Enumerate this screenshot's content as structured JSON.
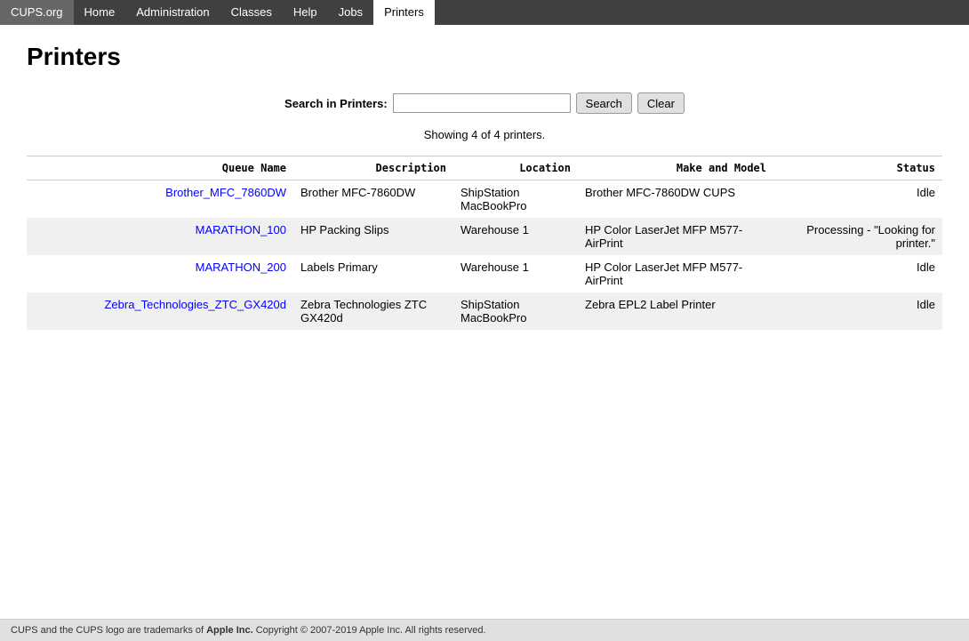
{
  "nav": {
    "brand": "CUPS.org",
    "items": [
      {
        "label": "Home",
        "href": "#",
        "active": false
      },
      {
        "label": "Administration",
        "href": "#",
        "active": false
      },
      {
        "label": "Classes",
        "href": "#",
        "active": false
      },
      {
        "label": "Help",
        "href": "#",
        "active": false
      },
      {
        "label": "Jobs",
        "href": "#",
        "active": false
      },
      {
        "label": "Printers",
        "href": "#",
        "active": true
      }
    ]
  },
  "page": {
    "title": "Printers",
    "search_label": "Search in Printers:",
    "search_value": "",
    "search_placeholder": "",
    "search_button": "Search",
    "clear_button": "Clear",
    "showing_text": "Showing 4 of 4 printers."
  },
  "table": {
    "headers": [
      "Queue Name",
      "Description",
      "Location",
      "Make and Model",
      "Status"
    ],
    "rows": [
      {
        "queue_name": "Brother_MFC_7860DW",
        "description": "Brother MFC-7860DW",
        "location": "ShipStation MacBookPro",
        "make_model": "Brother MFC-7860DW CUPS",
        "status": "Idle"
      },
      {
        "queue_name": "MARATHON_100",
        "description": "HP Packing Slips",
        "location": "Warehouse 1",
        "make_model": "HP Color LaserJet MFP M577-AirPrint",
        "status": "Processing - \"Looking for printer.\""
      },
      {
        "queue_name": "MARATHON_200",
        "description": "Labels Primary",
        "location": "Warehouse 1",
        "make_model": "HP Color LaserJet MFP M577-AirPrint",
        "status": "Idle"
      },
      {
        "queue_name": "Zebra_Technologies_ZTC_GX420d",
        "description": "Zebra Technologies ZTC GX420d",
        "location": "ShipStation MacBookPro",
        "make_model": "Zebra EPL2 Label Printer",
        "status": "Idle"
      }
    ]
  },
  "footer": {
    "text_before": "CUPS and the CUPS logo are trademarks of ",
    "brand": "Apple Inc.",
    "text_after": " Copyright © 2007-2019 Apple Inc. All rights reserved."
  }
}
